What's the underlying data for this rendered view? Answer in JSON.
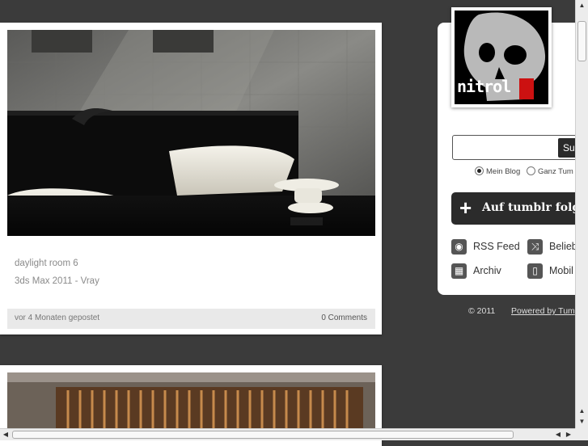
{
  "posts": [
    {
      "caption_title": "daylight room 6",
      "caption_subtitle": "3ds Max 2011 - Vray",
      "date": "vor 4 Monaten gepostet",
      "comments": "0 Comments"
    }
  ],
  "sidebar": {
    "avatar_text": "nitrol",
    "search_placeholder": "",
    "search_button": "Suc",
    "scope_options": [
      {
        "label": "Mein Blog",
        "selected": true
      },
      {
        "label": "Ganz Tum",
        "selected": false
      }
    ],
    "follow_button": "Auf tumblr folg",
    "links": [
      {
        "label": "RSS Feed",
        "icon": "rss-icon"
      },
      {
        "label": "Belieb",
        "icon": "shuffle-icon"
      },
      {
        "label": "Archiv",
        "icon": "archive-icon"
      },
      {
        "label": "Mobil",
        "icon": "mobile-icon"
      }
    ]
  },
  "footer": {
    "copyright": "© 2011",
    "powered_by": "Powered by Tum"
  },
  "colors": {
    "background": "#3b3b3b",
    "card": "#ffffff",
    "button_dark": "#2b2b2b",
    "avatar_accent": "#cc1111"
  }
}
